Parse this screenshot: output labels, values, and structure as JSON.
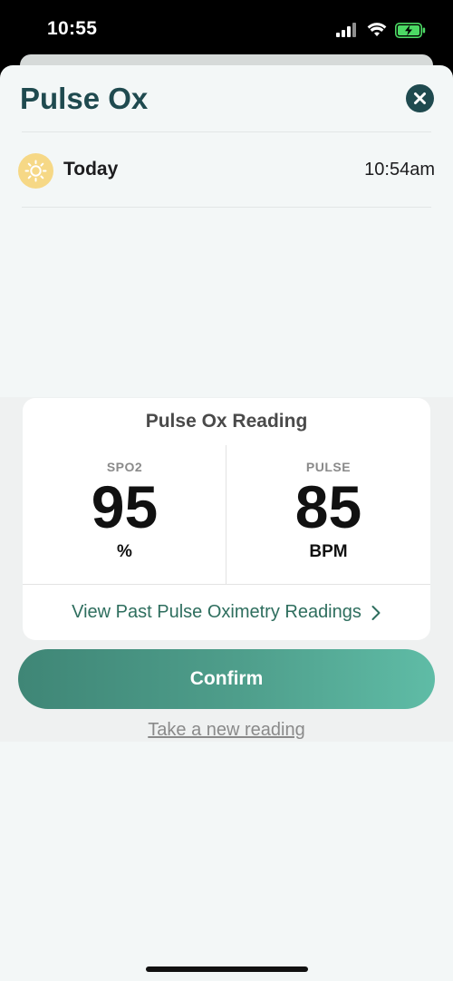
{
  "status_bar": {
    "time": "10:55",
    "icons": [
      "cellular-signal-icon",
      "wifi-icon",
      "battery-charging-icon"
    ],
    "battery_color": "#4cd964"
  },
  "sheet": {
    "title": "Pulse Ox",
    "close_icon": "close-icon",
    "day_icon": "sun-icon",
    "day_label": "Today",
    "time": "10:54am"
  },
  "reading_card": {
    "title": "Pulse Ox Reading",
    "spo2": {
      "label": "SPO2",
      "value": "95",
      "unit": "%"
    },
    "pulse": {
      "label": "PULSE",
      "value": "85",
      "unit": "BPM"
    },
    "past_link": "View Past Pulse Oximetry Readings",
    "past_link_icon": "chevron-right-icon"
  },
  "actions": {
    "confirm_label": "Confirm",
    "new_reading_label": "Take a new reading"
  },
  "colors": {
    "title": "#1f4a4f",
    "accent_green": "#4f9f8c",
    "link": "#2e6e5e",
    "sun_badge": "#f6d886"
  }
}
